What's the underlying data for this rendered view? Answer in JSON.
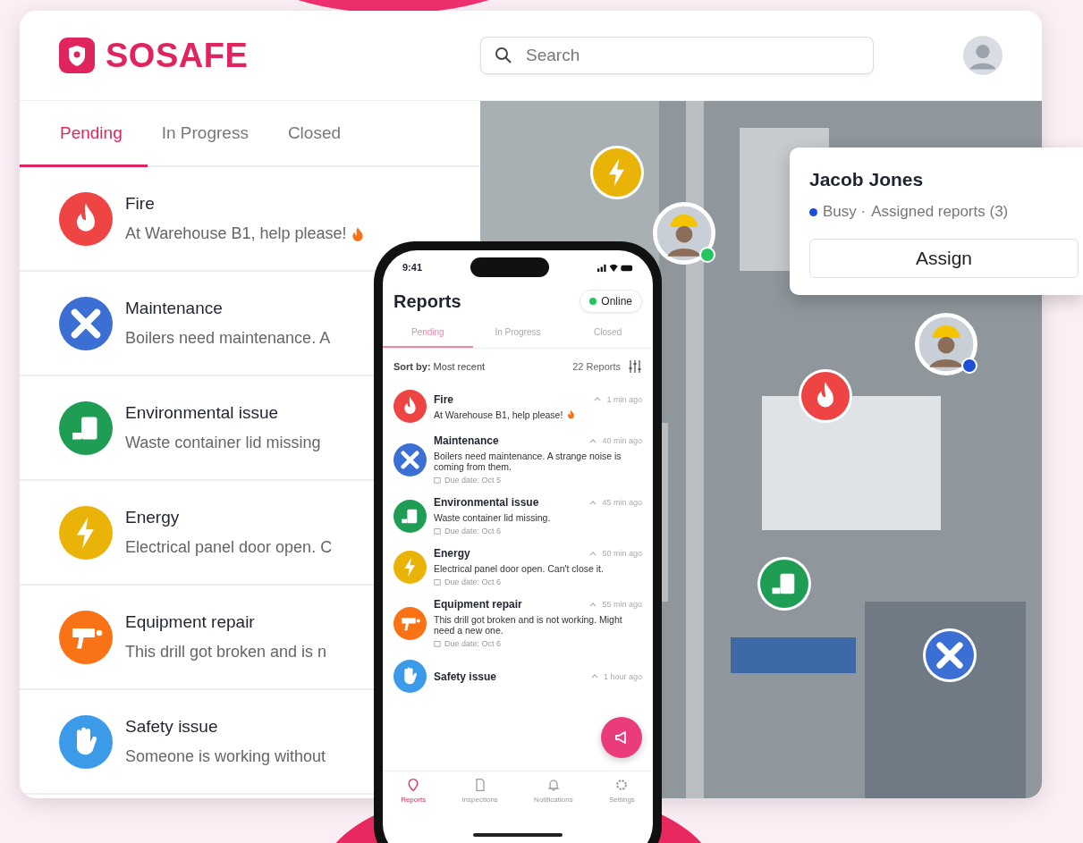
{
  "brand": {
    "name": "SOSAFE"
  },
  "search": {
    "placeholder": "Search"
  },
  "tabs": [
    {
      "label": "Pending",
      "selected": true
    },
    {
      "label": "In Progress",
      "selected": false
    },
    {
      "label": "Closed",
      "selected": false
    }
  ],
  "reports": [
    {
      "kind": "fire",
      "title": "Fire",
      "text": "At Warehouse B1, help please!",
      "flame": true
    },
    {
      "kind": "maintenance",
      "title": "Maintenance",
      "text": "Boilers need maintenance. A",
      "flame": false
    },
    {
      "kind": "environmental",
      "title": "Environmental issue",
      "text": "Waste container lid missing",
      "flame": false
    },
    {
      "kind": "energy",
      "title": "Energy",
      "text": "Electrical panel door open. C",
      "flame": false
    },
    {
      "kind": "repair",
      "title": "Equipment repair",
      "text": "This drill got broken and is n",
      "flame": false
    },
    {
      "kind": "safety",
      "title": "Safety issue",
      "text": "Someone is working without",
      "flame": false
    }
  ],
  "map": {
    "pins": [
      {
        "kind": "energy"
      },
      {
        "kind": "fire"
      },
      {
        "kind": "environmental"
      },
      {
        "kind": "maintenance"
      }
    ],
    "workers": [
      {
        "color": "#22c55e"
      },
      {
        "color": "#1d4ed8"
      }
    ]
  },
  "assign_popup": {
    "name": "Jacob Jones",
    "status": {
      "label": "Busy ·",
      "color": "#1d4ed8"
    },
    "assigned": "Assigned reports (3)",
    "button": "Assign"
  },
  "phone": {
    "time": "9:41",
    "title": "Reports",
    "connection": {
      "label": "Online",
      "color": "#22c55e"
    },
    "tabs": [
      {
        "label": "Pending",
        "selected": true
      },
      {
        "label": "In Progress",
        "selected": false
      },
      {
        "label": "Closed",
        "selected": false
      }
    ],
    "sort": "**Sort by:** Most recent",
    "count": "22 Reports",
    "reports": [
      {
        "kind": "fire",
        "title": "Fire",
        "time": "1 min ago",
        "text": "At Warehouse B1, help please!",
        "flame": true
      },
      {
        "kind": "maintenance",
        "title": "Maintenance",
        "time": "40 min ago",
        "text": "Boilers need maintenance. A strange noise is coming from them.",
        "due": "Due date: Oct 5",
        "flame": false
      },
      {
        "kind": "environmental",
        "title": "Environmental issue",
        "time": "45 min ago",
        "text": "Waste container lid missing.",
        "due": "Due date: Oct 6",
        "flame": false
      },
      {
        "kind": "energy",
        "title": "Energy",
        "time": "50 min ago",
        "text": "Electrical panel door open. Can't close it.",
        "due": "Due date: Oct 6",
        "flame": false
      },
      {
        "kind": "repair",
        "title": "Equipment repair",
        "time": "55 min ago",
        "text": "This drill got broken and is not working. Might need a new one.",
        "due": "Due date: Oct 6",
        "flame": false
      },
      {
        "kind": "safety",
        "title": "Safety issue",
        "time": "1 hour ago",
        "flame": false
      }
    ],
    "nav": [
      {
        "kind": "reports",
        "label": "Reports",
        "selected": true
      },
      {
        "kind": "inspections",
        "label": "Inspections",
        "selected": false
      },
      {
        "kind": "notifications",
        "label": "Notifications",
        "selected": false
      },
      {
        "kind": "settings",
        "label": "Settings",
        "selected": false
      }
    ]
  }
}
